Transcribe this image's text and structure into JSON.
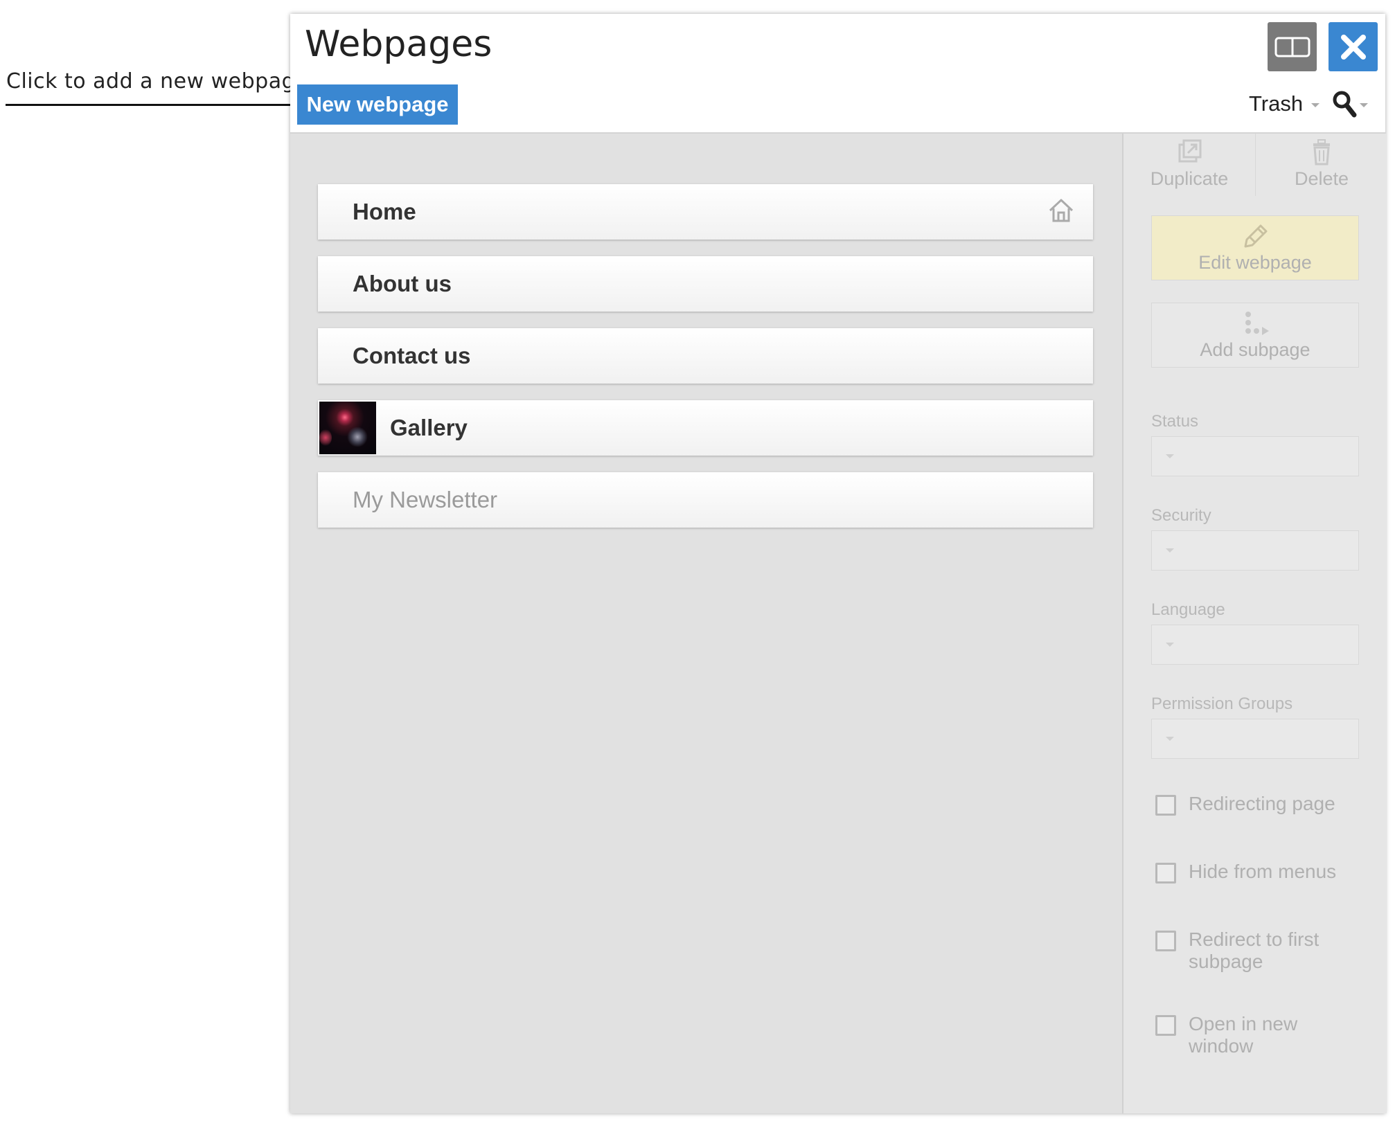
{
  "annotation": {
    "text": "Click to add a new webpage"
  },
  "window": {
    "title": "Webpages",
    "new_button_label": "New webpage",
    "trash_label": "Trash"
  },
  "pages": [
    {
      "label": "Home",
      "status": "published",
      "is_home": true
    },
    {
      "label": "About us",
      "status": "published"
    },
    {
      "label": "Contact us",
      "status": "published"
    },
    {
      "label": "Gallery",
      "status": "published",
      "has_thumbnail": true
    },
    {
      "label": "My Newsletter",
      "status": "draft"
    }
  ],
  "panel": {
    "duplicate_label": "Duplicate",
    "delete_label": "Delete",
    "edit_label": "Edit webpage",
    "add_subpage_label": "Add subpage",
    "fields": [
      {
        "label": "Status",
        "value": ""
      },
      {
        "label": "Security",
        "value": ""
      },
      {
        "label": "Language",
        "value": ""
      },
      {
        "label": "Permission Groups",
        "value": ""
      }
    ],
    "checkboxes": [
      {
        "label": "Redirecting page",
        "checked": false
      },
      {
        "label": "Hide from menus",
        "checked": false
      },
      {
        "label": "Redirect to first subpage",
        "checked": false
      },
      {
        "label": "Open in new window",
        "checked": false
      }
    ]
  },
  "colors": {
    "accent": "#3a87d1",
    "edit_button": "#f2ecc8",
    "content_bg": "#e1e1e1"
  },
  "icons": {
    "layout": "split-view-icon",
    "close": "close-icon",
    "search": "search-icon",
    "home": "home-icon",
    "duplicate": "duplicate-icon",
    "delete": "trash-icon",
    "edit": "pencil-icon",
    "add_subpage": "subpage-icon"
  }
}
